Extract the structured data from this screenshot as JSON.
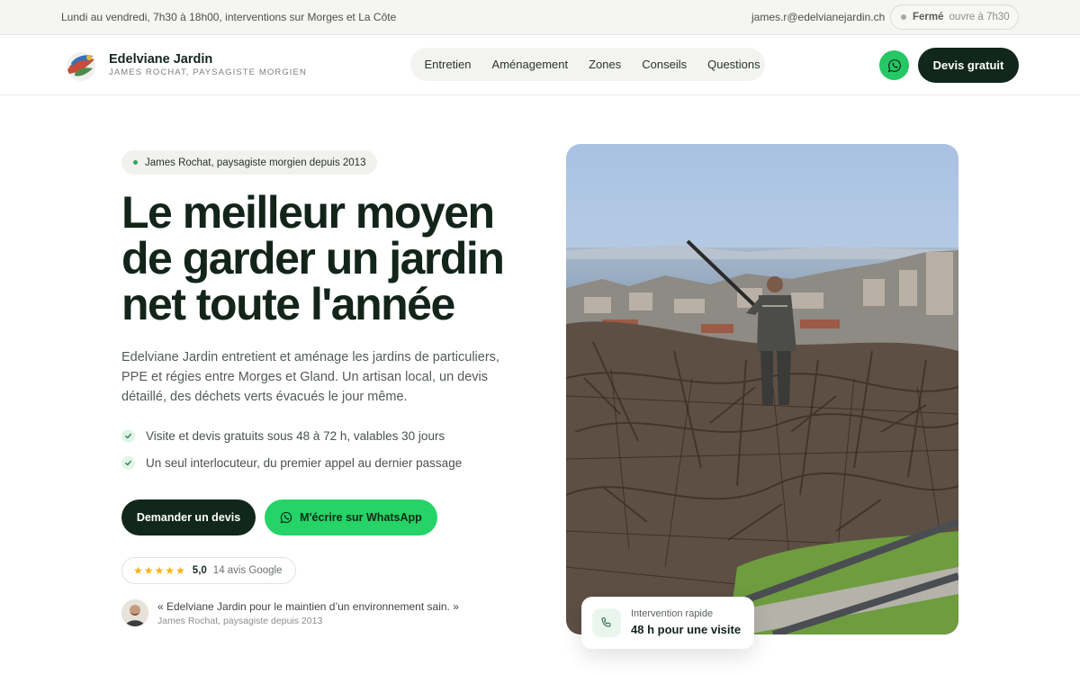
{
  "topbar": {
    "hours": "Lundi au vendredi, 7h30 à 18h00, interventions sur Morges et La Côte",
    "email": "james.r@edelvianejardin.ch",
    "status_label": "Fermé",
    "status_next": "ouvre à 7h30"
  },
  "header": {
    "brand_name": "Edelviane Jardin",
    "brand_tagline": "JAMES ROCHAT, PAYSAGISTE MORGIEN",
    "nav": [
      "Entretien",
      "Aménagement",
      "Zones",
      "Conseils",
      "Questions"
    ],
    "cta": "Devis gratuit"
  },
  "hero": {
    "badge": "James Rochat, paysagiste morgien depuis 2013",
    "headline": [
      "Le meilleur moyen",
      "de garder un jardin",
      "net toute l'année"
    ],
    "intro": "Edelviane Jardin entretient et aménage les jardins de particuliers, PPE et régies entre Morges et Gland. Un artisan local, un devis détaillé, des déchets verts évacués le jour même.",
    "checks": [
      "Visite et devis gratuits sous 48 à 72 h, valables 30 jours",
      "Un seul interlocuteur, du premier appel au dernier passage"
    ],
    "btn_primary": "Demander un devis",
    "btn_whatsapp": "M'écrire sur WhatsApp",
    "rating_stars": "★★★★★",
    "rating_score": "5,0",
    "rating_count": "14 avis Google",
    "quote": "« Edelviane Jardin pour le maintien d’un environnement sain. »",
    "quote_author": "James Rochat, paysagiste depuis 2013"
  },
  "card": {
    "label": "Intervention rapide",
    "value": "48 h pour une visite"
  },
  "icons": {
    "status": "status-dot-icon",
    "whatsapp": "whatsapp-icon",
    "check": "check-icon",
    "phone": "phone-icon",
    "star": "star-icon"
  },
  "colors": {
    "dark_green": "#11271c",
    "whatsapp_green": "#25d366",
    "star_yellow": "#f5b316"
  }
}
